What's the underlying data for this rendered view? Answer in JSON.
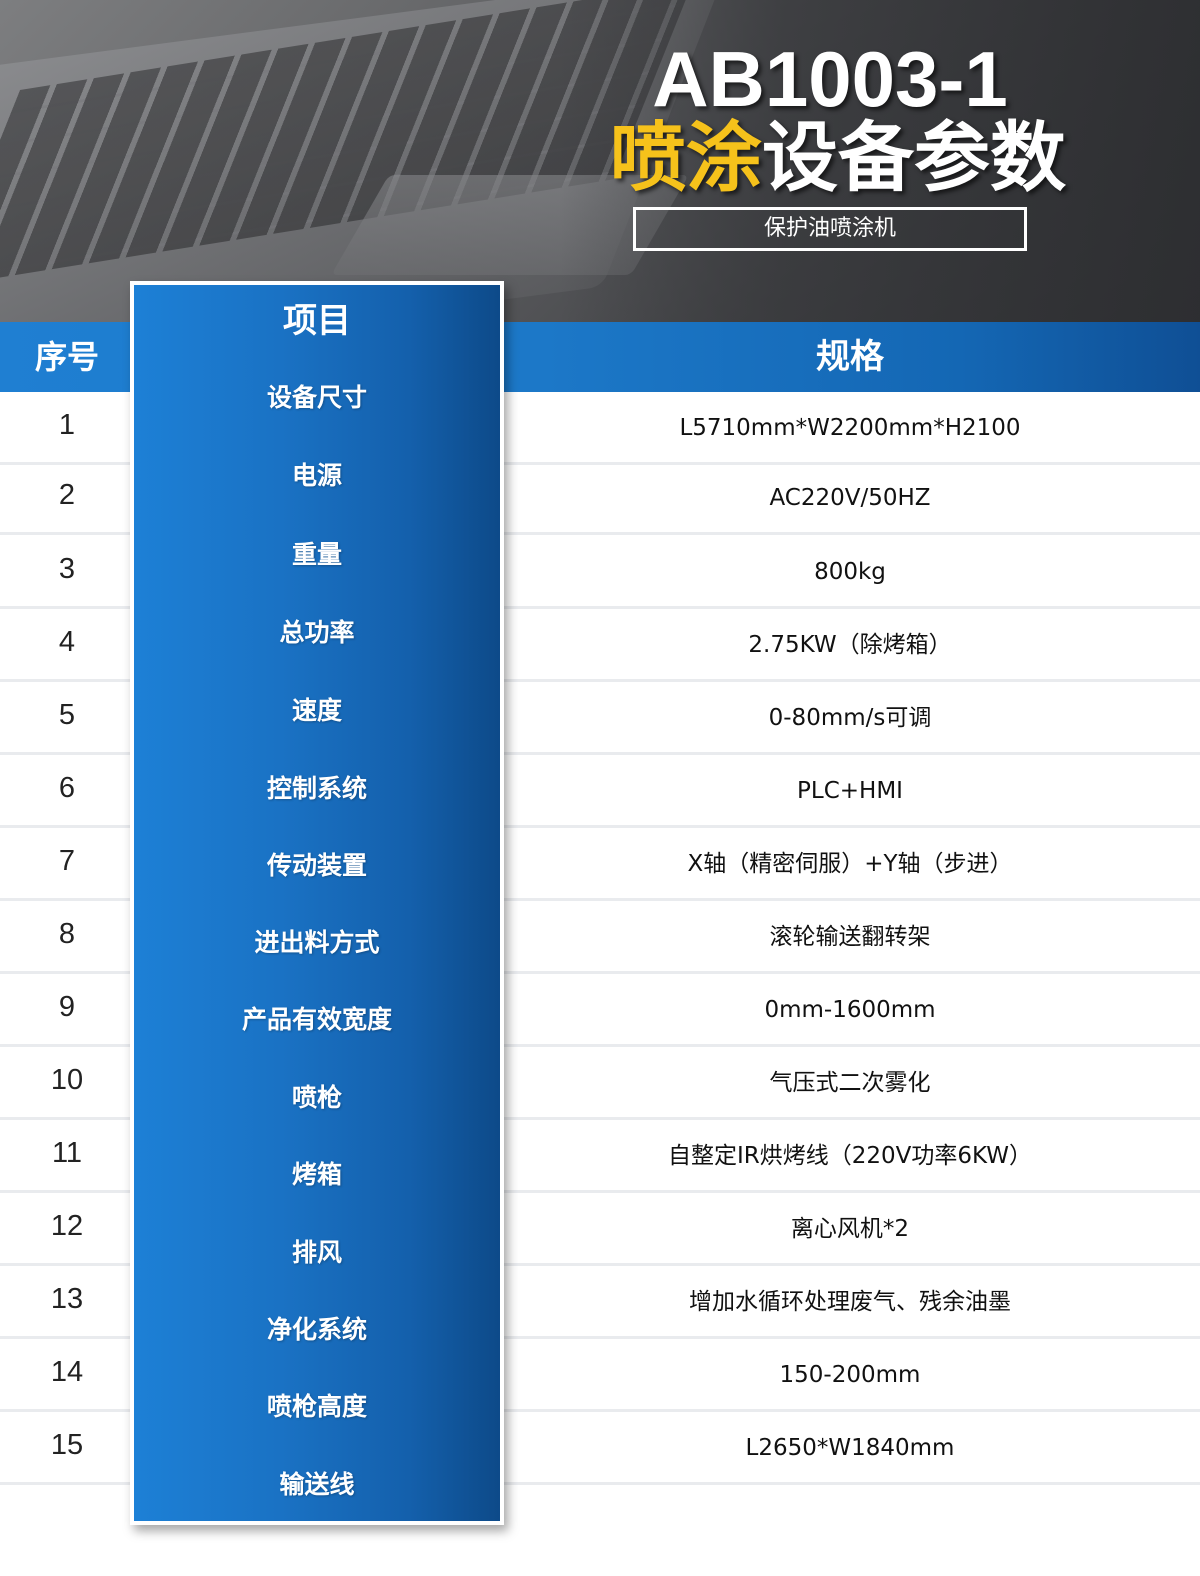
{
  "header": {
    "model": "AB1003-1",
    "title_highlight": "喷涂",
    "title_rest": "设备参数",
    "subtitle": "保护油喷涂机"
  },
  "columns": {
    "seq": "序号",
    "item": "项目",
    "spec": "规格"
  },
  "colors": {
    "accent_blue": "#1a72c4",
    "highlight_yellow": "#f6c21b"
  },
  "rows": [
    {
      "num": "1",
      "item": "设备尺寸",
      "spec": "L5710mm*W2200mm*H2100"
    },
    {
      "num": "2",
      "item": "电源",
      "spec": "AC220V/50HZ"
    },
    {
      "num": "3",
      "item": "重量",
      "spec": "800kg"
    },
    {
      "num": "4",
      "item": "总功率",
      "spec": "2.75KW（除烤箱）"
    },
    {
      "num": "5",
      "item": "速度",
      "spec": "0-80mm/s可调"
    },
    {
      "num": "6",
      "item": "控制系统",
      "spec": "PLC+HMI"
    },
    {
      "num": "7",
      "item": "传动装置",
      "spec": "X轴（精密伺服）+Y轴（步进）"
    },
    {
      "num": "8",
      "item": "进出料方式",
      "spec": "滚轮输送翻转架"
    },
    {
      "num": "9",
      "item": "产品有效宽度",
      "spec": "0mm-1600mm"
    },
    {
      "num": "10",
      "item": "喷枪",
      "spec": "气压式二次雾化"
    },
    {
      "num": "11",
      "item": "烤箱",
      "spec": "自整定IR烘烤线（220V功率6KW）"
    },
    {
      "num": "12",
      "item": "排风",
      "spec": "离心风机*2"
    },
    {
      "num": "13",
      "item": "净化系统",
      "spec": "增加水循环处理废气、残余油墨"
    },
    {
      "num": "14",
      "item": "喷枪高度",
      "spec": "150-200mm"
    },
    {
      "num": "15",
      "item": "输送线",
      "spec": "L2650*W1840mm"
    }
  ]
}
